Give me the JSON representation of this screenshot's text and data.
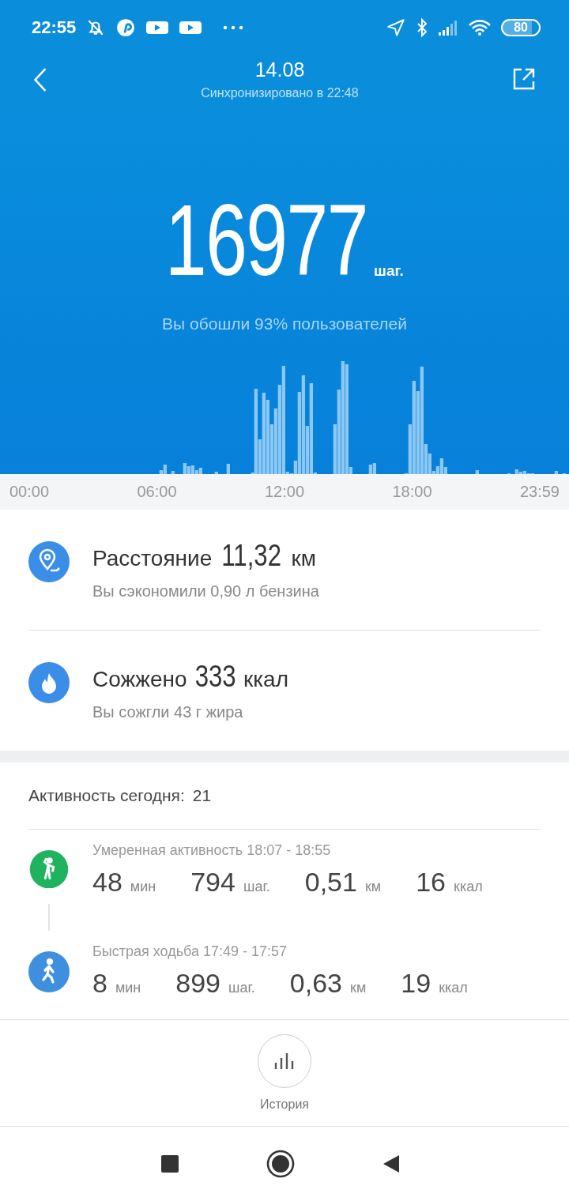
{
  "status_bar": {
    "time": "22:55",
    "battery": "80"
  },
  "header": {
    "title": "14.08",
    "subtitle": "Синхронизировано в 22:48"
  },
  "steps": {
    "value": "16977",
    "unit": "шаг.",
    "comparison": "Вы обошли 93% пользователей"
  },
  "timeline": {
    "labels": [
      "00:00",
      "06:00",
      "12:00",
      "18:00",
      "23:59"
    ]
  },
  "summary": [
    {
      "kind": "distance",
      "label": "Расстояние",
      "value": "11,32",
      "unit": "км",
      "note": "Вы сэкономили 0,90 л бензина"
    },
    {
      "kind": "calories",
      "label": "Сожжено",
      "value": "333",
      "unit": "ккал",
      "note": "Вы сожгли 43 г жира"
    }
  ],
  "activity": {
    "title": "Активность сегодня:",
    "count": "21",
    "items": [
      {
        "kind": "moderate",
        "color": "#1fb35f",
        "title": "Умеренная активность 18:07 - 18:55",
        "stats": [
          {
            "value": "48",
            "unit": "мин"
          },
          {
            "value": "794",
            "unit": "шаг."
          },
          {
            "value": "0,51",
            "unit": "км"
          },
          {
            "value": "16",
            "unit": "ккал"
          }
        ]
      },
      {
        "kind": "walk",
        "color": "#3f8fe0",
        "title": "Быстрая ходьба 17:49 - 17:57",
        "stats": [
          {
            "value": "8",
            "unit": "мин"
          },
          {
            "value": "899",
            "unit": "шаг."
          },
          {
            "value": "0,63",
            "unit": "км"
          },
          {
            "value": "19",
            "unit": "ккал"
          }
        ]
      }
    ]
  },
  "bottom": {
    "history_label": "История"
  }
}
